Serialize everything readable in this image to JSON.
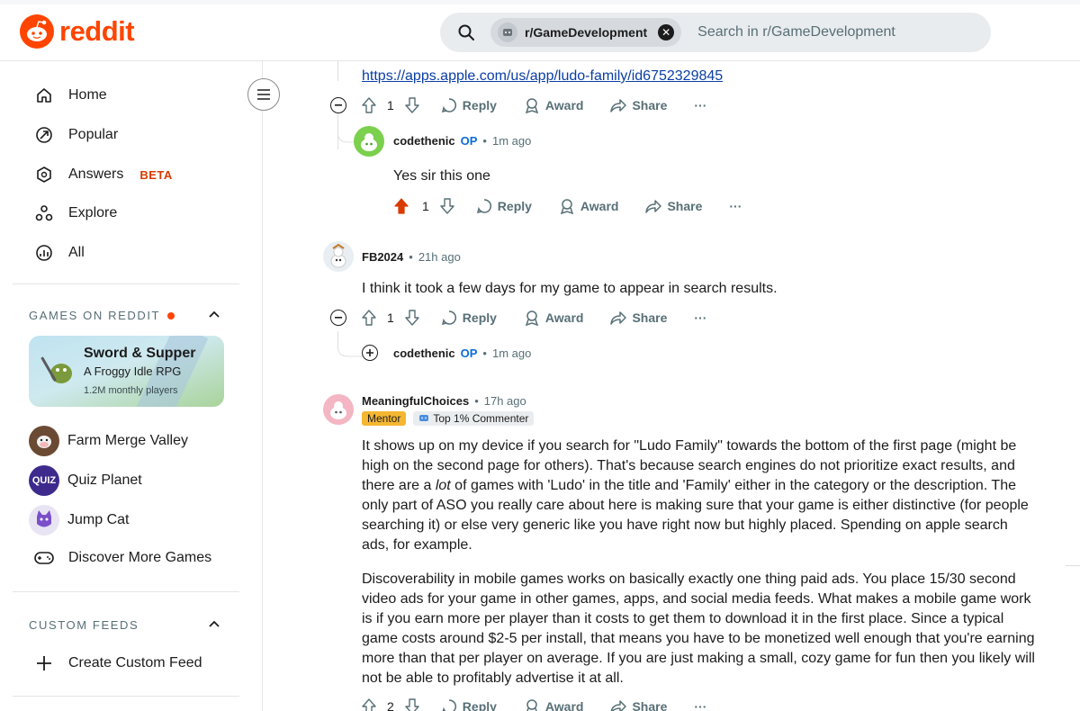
{
  "header": {
    "brand": "reddit",
    "search_chip": "r/GameDevelopment",
    "search_placeholder": "Search in r/GameDevelopment",
    "colors": {
      "brand": "#ff4500",
      "search_bg": "#e9ecef"
    }
  },
  "sidebar": {
    "nav": [
      {
        "label": "Home",
        "icon": "home-icon"
      },
      {
        "label": "Popular",
        "icon": "popular-icon"
      },
      {
        "label": "Answers",
        "icon": "answers-icon",
        "badge": "BETA"
      },
      {
        "label": "Explore",
        "icon": "explore-icon"
      },
      {
        "label": "All",
        "icon": "all-icon"
      }
    ],
    "games_title": "GAMES ON REDDIT",
    "featured_game": {
      "title": "Sword & Supper",
      "subtitle": "A Froggy Idle RPG",
      "players": "1.2M monthly players"
    },
    "games": [
      {
        "label": "Farm Merge Valley"
      },
      {
        "label": "Quiz Planet",
        "icon_text": "QUIZ"
      },
      {
        "label": "Jump Cat"
      },
      {
        "label": "Discover More Games"
      }
    ],
    "custom_feeds_title": "CUSTOM FEEDS",
    "create_feed": "Create Custom Feed"
  },
  "thread": {
    "link": "https://apps.apple.com/us/app/ludo-family/id6752329845",
    "actions": {
      "reply": "Reply",
      "award": "Award",
      "share": "Share",
      "more": "···"
    },
    "comments": [
      {
        "vote_count": "1"
      },
      {
        "author": "codethenic",
        "op": "OP",
        "time": "1m ago",
        "body": "Yes sir this one",
        "vote_count": "1"
      },
      {
        "author": "FB2024",
        "time": "21h ago",
        "body": "I think it took a few days for my game to appear in search results.",
        "vote_count": "1"
      },
      {
        "author": "codethenic",
        "op": "OP",
        "time": "1m ago"
      },
      {
        "author": "MeaningfulChoices",
        "time": "17h ago",
        "flair": "Mentor",
        "commenter_badge": "Top 1% Commenter",
        "p1_a": "It shows up on my device if you search for \"Ludo Family\" towards the bottom of the first page (might be high on the second page for others). That's because search engines do not prioritize exact results, and there are a ",
        "p1_em": "lot",
        "p1_b": " of games with 'Ludo' in the title and 'Family' either in the category or the description. The only part of ASO you really care about here is making sure that your game is either distinctive (for people searching it) or else very generic like you have right now but highly placed. Spending on apple search ads, for example.",
        "p2": "Discoverability in mobile games works on basically exactly one thing paid ads. You place 15/30 second video ads for your game in other games, apps, and social media feeds. What makes a mobile game work is if you earn more per player than it costs to get them to download it in the first place. Since a typical game costs around $2-5 per install, that means you have to be monetized well enough that you're earning more than that per player on average. If you are just making a small, cozy game for fun then you likely will not be able to profitably advertise it at all.",
        "vote_count": "2"
      }
    ]
  }
}
